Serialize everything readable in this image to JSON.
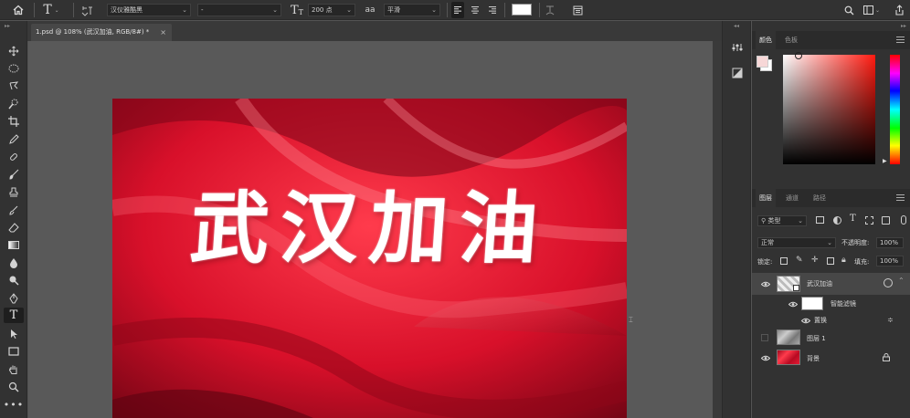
{
  "options_bar": {
    "font_family": "汉仪雅酷黑",
    "font_style": "-",
    "font_size": "200 点",
    "anti_alias_icon_text": "aa",
    "anti_alias": "平滑",
    "text_color": "#ffffff"
  },
  "document_tab": {
    "title": "1.psd @ 108% (武汉加油, RGB/8#) *",
    "close": "×"
  },
  "canvas": {
    "text": "武汉加油",
    "background_color": "#c8102e"
  },
  "color_panel": {
    "tabs": [
      "颜色",
      "色板"
    ],
    "foreground": "#f7d7d7",
    "background": "#ffffff"
  },
  "layers_panel": {
    "tabs": [
      "图层",
      "通道",
      "路径"
    ],
    "filter_kind": "类型",
    "blend_mode": "正常",
    "opacity_label": "不透明度:",
    "opacity_value": "100%",
    "lock_label": "锁定:",
    "fill_label": "填充:",
    "fill_value": "100%",
    "layers": [
      {
        "name": "武汉加油",
        "visible": true,
        "type": "smart-object"
      },
      {
        "name": "智能滤镜",
        "visible": true,
        "type": "smart-filter"
      },
      {
        "name": "置换",
        "visible": true,
        "type": "filter"
      },
      {
        "name": "图层 1",
        "visible": false,
        "type": "pixel"
      },
      {
        "name": "背景",
        "visible": true,
        "type": "background"
      }
    ]
  }
}
